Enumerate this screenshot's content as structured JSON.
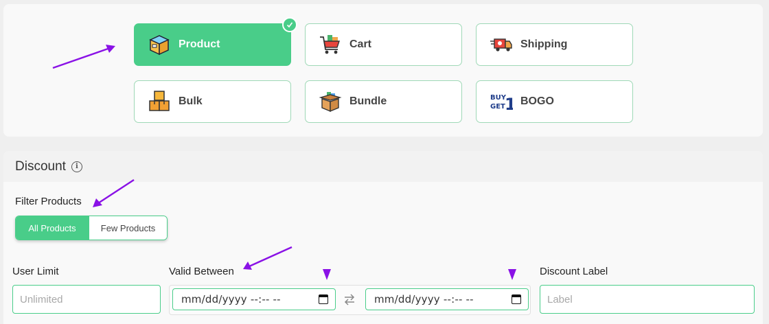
{
  "rule_types": [
    {
      "label": "Product",
      "icon": "product-box-icon",
      "active": true
    },
    {
      "label": "Cart",
      "icon": "shopping-cart-icon",
      "active": false
    },
    {
      "label": "Shipping",
      "icon": "delivery-truck-icon",
      "active": false
    },
    {
      "label": "Bulk",
      "icon": "stacked-boxes-icon",
      "active": false
    },
    {
      "label": "Bundle",
      "icon": "open-box-icon",
      "active": false
    },
    {
      "label": "BOGO",
      "icon": "buy-get-one-icon",
      "active": false
    }
  ],
  "bogo_icon_text": {
    "line1": "BUY",
    "line2": "GET",
    "digit": "1"
  },
  "discount": {
    "title": "Discount",
    "filter_label": "Filter Products",
    "filter_options": [
      "All Products",
      "Few Products"
    ],
    "filter_selected": "All Products",
    "user_limit_label": "User Limit",
    "user_limit_placeholder": "Unlimited",
    "valid_between_label": "Valid Between",
    "date_from": "mm/dd/yyyy --:-- --",
    "date_to": "mm/dd/yyyy --:-- --",
    "discount_label_label": "Discount Label",
    "discount_label_placeholder": "Label"
  },
  "colors": {
    "accent": "#49cd89",
    "annotation": "#8a12e6"
  }
}
